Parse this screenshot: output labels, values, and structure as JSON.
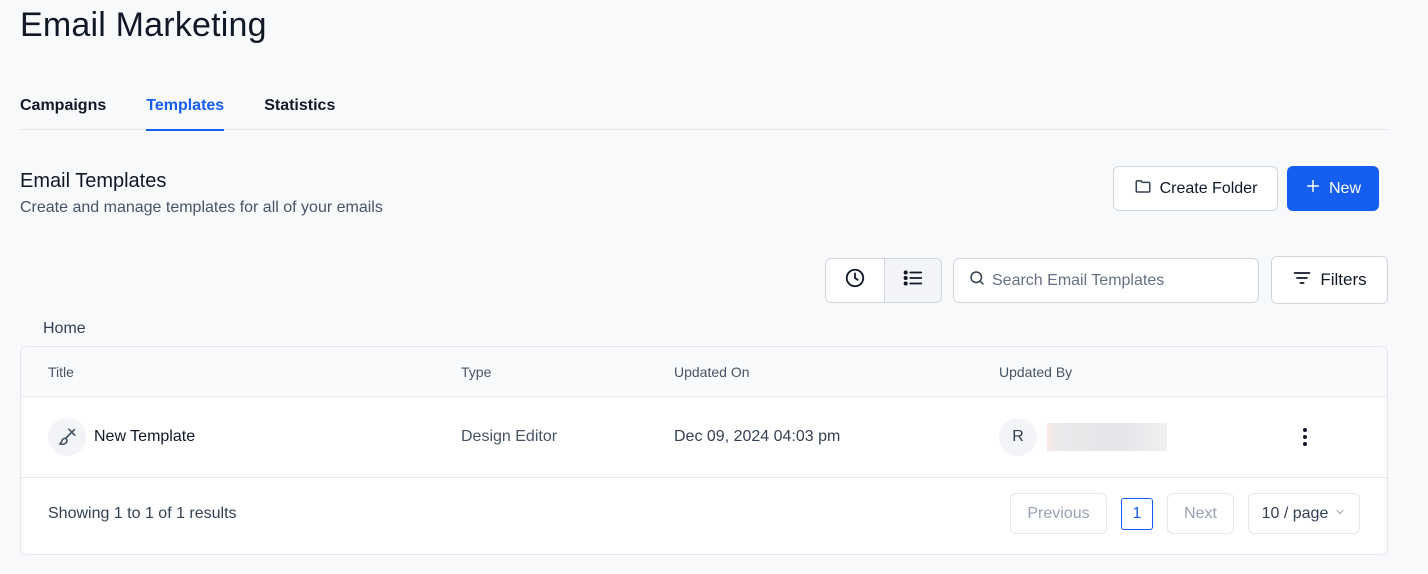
{
  "page": {
    "title": "Email Marketing"
  },
  "tabs": [
    {
      "label": "Campaigns",
      "active": false
    },
    {
      "label": "Templates",
      "active": true
    },
    {
      "label": "Statistics",
      "active": false
    }
  ],
  "section": {
    "title": "Email Templates",
    "subtitle": "Create and manage templates for all of your emails"
  },
  "actions": {
    "create_folder": "Create Folder",
    "new": "New",
    "filters": "Filters"
  },
  "search": {
    "placeholder": "Search Email Templates"
  },
  "breadcrumb": "Home",
  "table": {
    "columns": [
      "Title",
      "Type",
      "Updated On",
      "Updated By"
    ],
    "rows": [
      {
        "title": "New Template",
        "type": "Design Editor",
        "updated_on": "Dec 09, 2024 04:03 pm",
        "updated_by_initial": "R"
      }
    ]
  },
  "pagination": {
    "showing": "Showing 1 to 1 of 1 results",
    "previous": "Previous",
    "current_page": "1",
    "next": "Next",
    "page_size": "10 / page"
  },
  "colors": {
    "accent": "#155eef",
    "background": "#f8f9fb",
    "border": "#d0d5dd"
  },
  "icons": {
    "create_folder": "folder-icon",
    "new": "plus-icon",
    "recent": "clock-icon",
    "list": "list-icon",
    "search": "search-icon",
    "filters": "filter-icon",
    "row": "brush-icon",
    "more": "kebab-icon",
    "page_size": "chevron-down-icon"
  }
}
